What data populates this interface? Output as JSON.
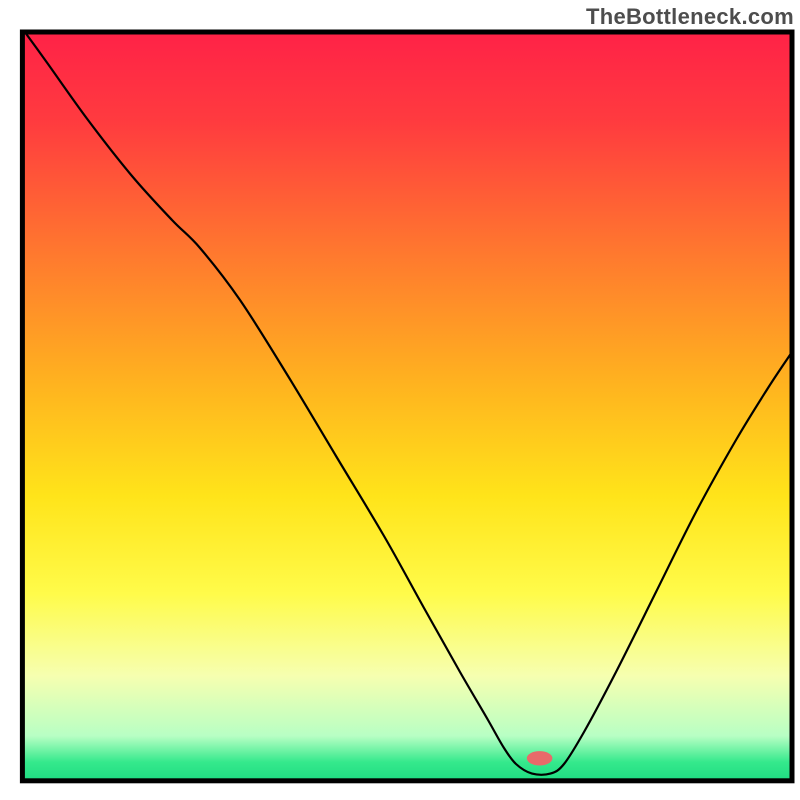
{
  "watermark": "TheBottleneck.com",
  "chart_data": {
    "type": "line",
    "title": "",
    "xlabel": "",
    "ylabel": "",
    "xlim": [
      0,
      100
    ],
    "ylim": [
      0,
      100
    ],
    "grid": false,
    "legend": false,
    "annotations": [],
    "background": {
      "type": "vertical-gradient",
      "stops": [
        {
          "pos": 0.0,
          "color": "#ff2247"
        },
        {
          "pos": 0.12,
          "color": "#ff3b3f"
        },
        {
          "pos": 0.3,
          "color": "#ff7a2e"
        },
        {
          "pos": 0.47,
          "color": "#ffb31f"
        },
        {
          "pos": 0.62,
          "color": "#ffe41a"
        },
        {
          "pos": 0.75,
          "color": "#fffb4a"
        },
        {
          "pos": 0.86,
          "color": "#f6ffb0"
        },
        {
          "pos": 0.94,
          "color": "#b8ffc4"
        },
        {
          "pos": 0.975,
          "color": "#35e98c"
        },
        {
          "pos": 1.0,
          "color": "#1edc82"
        }
      ]
    },
    "frame": {
      "left_pct": 2.8,
      "top_pct": 4.0,
      "right_pct": 99.0,
      "bottom_pct": 97.6,
      "stroke": "#000000",
      "stroke_width": 5
    },
    "marker": {
      "x": 67.2,
      "y": 3.0,
      "color": "#e86a6a",
      "rx_pct": 1.6,
      "ry_pct": 0.9
    },
    "curve": {
      "stroke": "#000000",
      "stroke_width": 2.2,
      "points_pct_from_topleft": [
        [
          3.1,
          4.0
        ],
        [
          6.0,
          8.0
        ],
        [
          11.0,
          15.0
        ],
        [
          16.5,
          22.0
        ],
        [
          21.5,
          27.5
        ],
        [
          25.0,
          31.0
        ],
        [
          30.0,
          37.5
        ],
        [
          36.0,
          47.0
        ],
        [
          42.0,
          57.0
        ],
        [
          48.0,
          67.0
        ],
        [
          53.0,
          76.0
        ],
        [
          57.5,
          84.0
        ],
        [
          61.0,
          90.0
        ],
        [
          63.0,
          93.5
        ],
        [
          64.5,
          95.5
        ],
        [
          66.5,
          96.7
        ],
        [
          68.8,
          96.7
        ],
        [
          70.5,
          95.5
        ],
        [
          73.0,
          91.5
        ],
        [
          77.0,
          84.0
        ],
        [
          82.0,
          74.0
        ],
        [
          87.0,
          64.0
        ],
        [
          92.0,
          55.0
        ],
        [
          96.0,
          48.5
        ],
        [
          99.0,
          44.0
        ]
      ]
    }
  }
}
